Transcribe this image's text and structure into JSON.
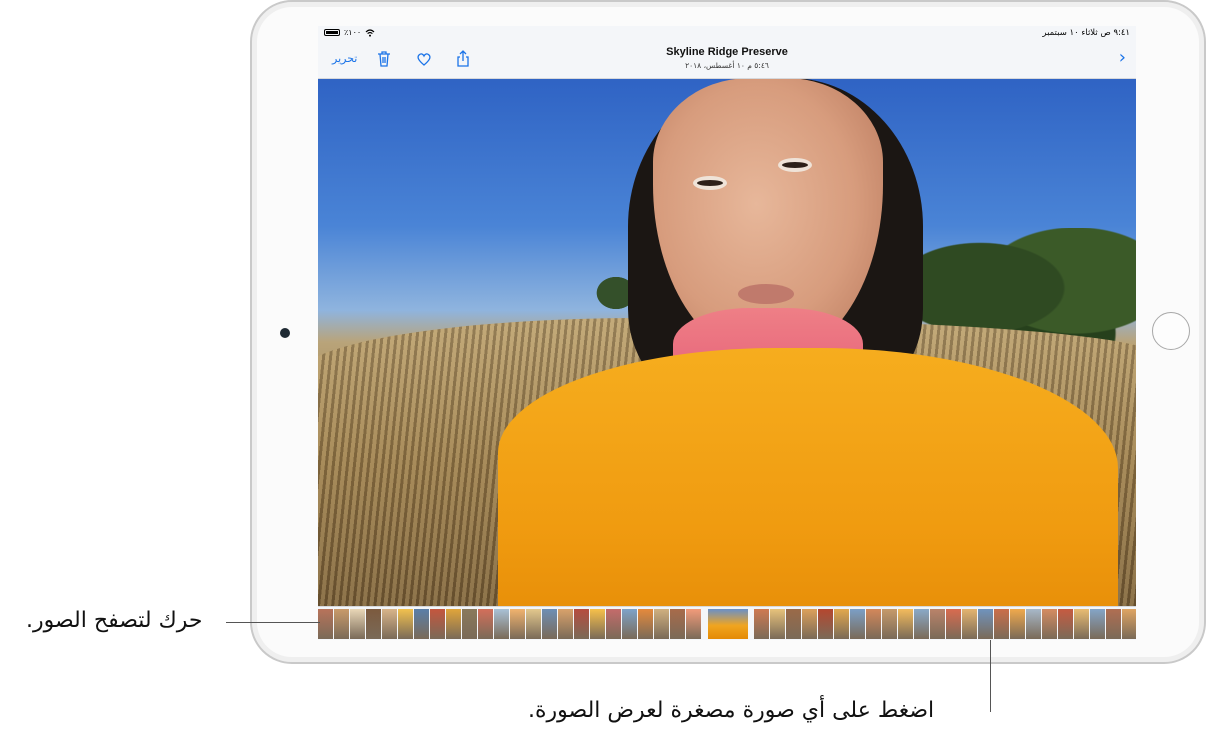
{
  "statusbar": {
    "time_date": "٩:٤١ ص   ثلاثاء ١٠ سبتمبر",
    "battery": "٪١٠٠"
  },
  "toolbar": {
    "title": "Skyline Ridge Preserve",
    "subtitle": "٥:٤٦ م ١٠ أغسطس، ٢٠١٨",
    "edit_label": "تحرير",
    "icons": [
      "back-chevron-icon",
      "share-icon",
      "heart-icon",
      "trash-icon"
    ]
  },
  "thumbnail_strip": {
    "thumb_colors": [
      "#b8735a",
      "#c99a6a",
      "#e9d7b7",
      "#7c5a3e",
      "#d8b48a",
      "#f2c14e",
      "#5a7fa8",
      "#c4563e",
      "#e0a53a",
      "#8a7a5c",
      "#d36f5a",
      "#a9c1d6",
      "#f1b36e",
      "#e3c88d",
      "#6e8fb5",
      "#d9a26b",
      "#b64d3f",
      "#f7c04a",
      "#c46b6b",
      "#7ea3c9",
      "#e58a3c",
      "#d0b080",
      "#a86b4a",
      "#f29b7a",
      "#5b82b6",
      "#cf7a52",
      "#e7c27b",
      "#9b6a48",
      "#dca05a",
      "#b5472f",
      "#e2a84d",
      "#7b9fc6",
      "#d3885a",
      "#c69a6b",
      "#f3bb5c",
      "#8aa9c8",
      "#b9836a",
      "#d96b4f",
      "#e4b46f",
      "#6f93bd",
      "#cb6f4a",
      "#f0a94c",
      "#a7b8c9",
      "#d58c62",
      "#c65b41",
      "#e9bc72",
      "#84a5c7",
      "#b06e52",
      "#dfa563",
      "#c4412f",
      "#f5b34a",
      "#9db5cc",
      "#cf8a5c",
      "#e2b277",
      "#b8584a",
      "#e89c48",
      "#7d9ec4",
      "#d4a06a",
      "#c96b50",
      "#f1c26a"
    ],
    "selected_index": 24
  },
  "callouts": {
    "scroll": "حرك لتصفح الصور.",
    "tap": "اضغط على أي صورة مصغرة لعرض الصورة."
  }
}
